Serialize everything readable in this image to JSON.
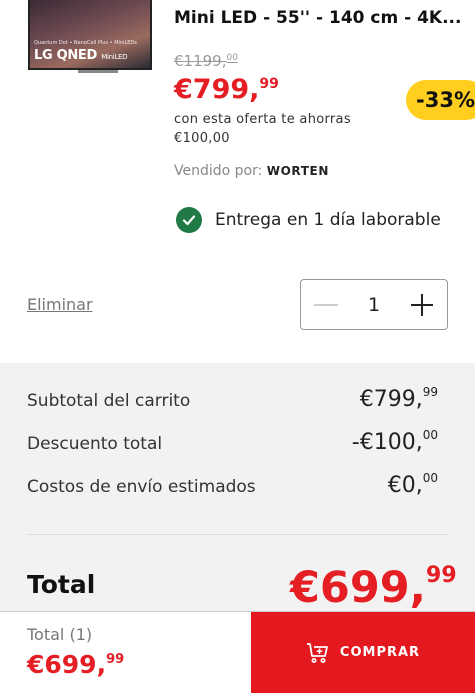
{
  "product": {
    "image_badge": "Quantum Dot • NanoCell Plus • MiniLEDs",
    "image_brand": "LG QNED",
    "image_brand_sub": "MiniLED",
    "title": "Mini LED - 55'' - 140 cm - 4K...",
    "old_price_main": "€1199,",
    "old_price_cents": "00",
    "new_price_main": "€799,",
    "new_price_cents": "99",
    "discount_badge": "-33%",
    "offer_line1": "con esta oferta te ahorras",
    "offer_line2": "€100,00",
    "seller_label": "Vendido por:",
    "seller_name": "WORTEN",
    "delivery_text": "Entrega en 1 día laborable"
  },
  "cart_item": {
    "remove_label": "Eliminar",
    "quantity": "1"
  },
  "summary": {
    "subtotal_label": "Subtotal del carrito",
    "subtotal_main": "€799,",
    "subtotal_cents": "99",
    "discount_label": "Descuento total",
    "discount_main": "-€100,",
    "discount_cents": "00",
    "shipping_label": "Costos de envío estimados",
    "shipping_main": "€0,",
    "shipping_cents": "00",
    "total_label": "Total",
    "total_main": "€699,",
    "total_cents": "99"
  },
  "footer": {
    "total_label": "Total (1)",
    "price_main": "€699,",
    "price_cents": "99",
    "buy_label": "COMPRAR"
  },
  "colors": {
    "accent_red": "#e51e24",
    "badge_yellow": "#ffce1f",
    "check_green": "#1f7a45"
  }
}
